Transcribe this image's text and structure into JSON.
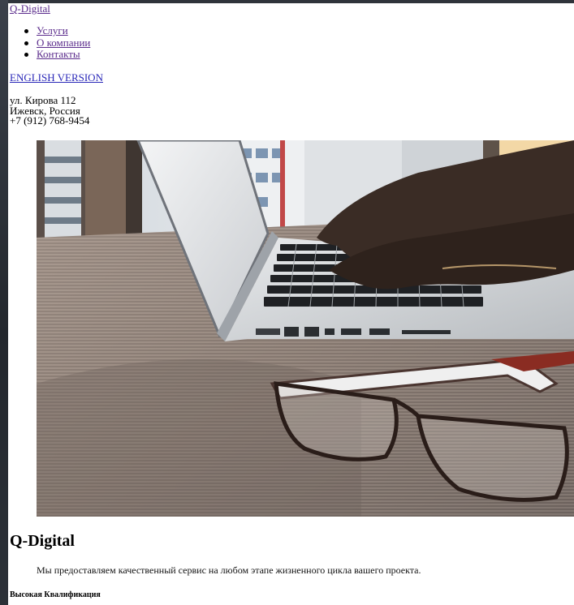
{
  "header": {
    "brand": "Q-Digital"
  },
  "nav": {
    "items": [
      {
        "label": "Услуги"
      },
      {
        "label": "О компании"
      },
      {
        "label": "Контакты"
      }
    ]
  },
  "language_link": "ENGLISH VERSION",
  "contact": {
    "street": "ул. Кирова 112",
    "city": "Ижевск, Россия",
    "phone": "+7 (912) 768-9454"
  },
  "hero": {
    "image": "laptop-typing-glasses-photo"
  },
  "main": {
    "title": "Q-Digital",
    "lead": "Мы предоставляем качественный сервис на любом этапе жизненного цикла вашего проекта.",
    "feature_heading": "Высокая Квалификация"
  },
  "colors": {
    "link": "#2a28b8",
    "visited_link": "#5b2c8c",
    "frame": "#2a2f36"
  }
}
